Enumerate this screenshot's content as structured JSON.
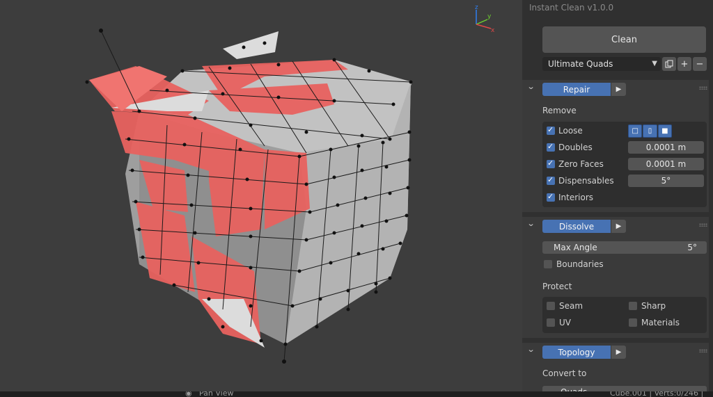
{
  "panel": {
    "title": "Instant Clean v1.0.0",
    "clean_button": "Clean",
    "preset": "Ultimate Quads",
    "preset_chevron_icon": "chevron-down-icon"
  },
  "repair": {
    "button": "Repair",
    "remove_label": "Remove",
    "items": [
      {
        "label": "Loose",
        "checked": true
      },
      {
        "label": "Doubles",
        "checked": true,
        "value": "0.0001 m"
      },
      {
        "label": "Zero Faces",
        "checked": true,
        "value": "0.0001 m"
      },
      {
        "label": "Dispensables",
        "checked": true,
        "value": "5°"
      },
      {
        "label": "Interiors",
        "checked": true
      }
    ]
  },
  "dissolve": {
    "button": "Dissolve",
    "max_angle_label": "Max Angle",
    "max_angle_value": "5°",
    "boundaries_label": "Boundaries",
    "protect_label": "Protect",
    "protect": [
      {
        "label": "Seam",
        "checked": false
      },
      {
        "label": "Sharp",
        "checked": false
      },
      {
        "label": "UV",
        "checked": false
      },
      {
        "label": "Materials",
        "checked": false
      }
    ]
  },
  "topology": {
    "button": "Topology",
    "convert_label": "Convert to",
    "convert_value": "Quads"
  },
  "gizmo": {
    "x": "x",
    "y": "y",
    "z": "z"
  },
  "statusbar": {
    "pan_view": "Pan View",
    "info": "Cube.001 | Verts:0/246 |"
  },
  "colors": {
    "accent": "#4772b3",
    "highlight_faces": "#e8625f",
    "mesh_grey": "#bdbdbd"
  }
}
